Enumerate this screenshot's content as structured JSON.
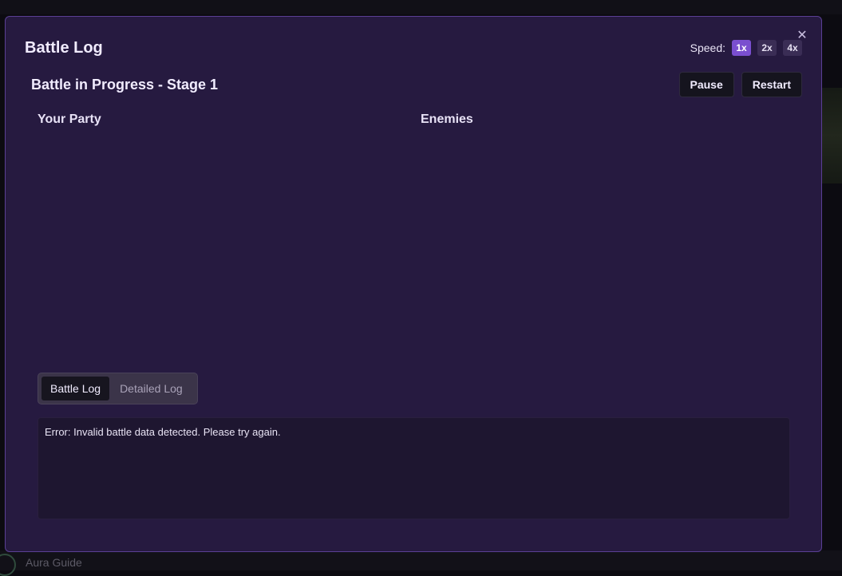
{
  "background": {
    "guide_label": "Aura Guide"
  },
  "modal": {
    "title": "Battle Log",
    "close_icon": "close-icon",
    "speed": {
      "label": "Speed:",
      "options": [
        "1x",
        "2x",
        "4x"
      ],
      "selected": "1x"
    },
    "status": "Battle in Progress - Stage 1",
    "actions": {
      "pause_label": "Pause",
      "restart_label": "Restart"
    },
    "party_heading": "Your Party",
    "enemies_heading": "Enemies",
    "tabs": [
      {
        "label": "Battle Log",
        "active": true
      },
      {
        "label": "Detailed Log",
        "active": false
      }
    ],
    "log_lines": [
      "Error: Invalid battle data detected. Please try again."
    ]
  },
  "colors": {
    "modal_bg": "#261a40",
    "modal_border": "#5a3f94",
    "accent": "#7a4fcf",
    "log_bg": "#1e1630"
  }
}
